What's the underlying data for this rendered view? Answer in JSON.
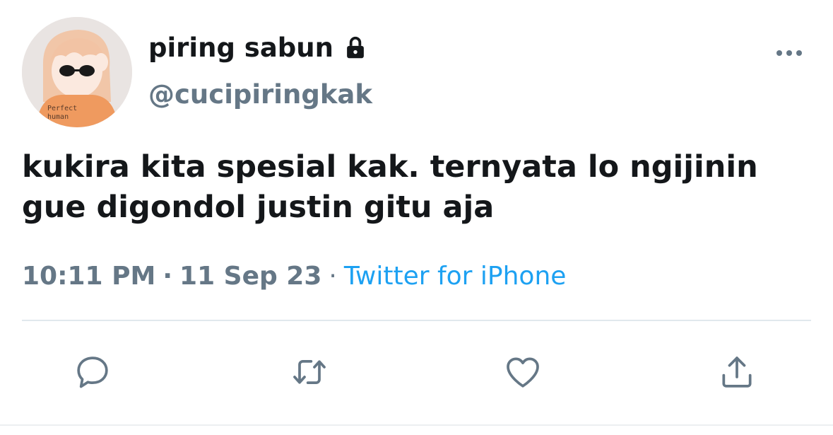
{
  "user": {
    "display_name": "piring sabun",
    "handle": "@cucipiringkak",
    "avatar_shirt_text": "Perfect human",
    "protected_icon": "lock-icon"
  },
  "tweet": {
    "text": "kukira kita spesial kak. ternyata lo ngijinin gue digondol justin gitu aja",
    "time": "10:11 PM",
    "date": "11 Sep 23",
    "separator": "·",
    "source": "Twitter for iPhone"
  },
  "actions": [
    {
      "name": "reply",
      "icon": "reply-icon"
    },
    {
      "name": "retweet",
      "icon": "retweet-icon"
    },
    {
      "name": "like",
      "icon": "heart-icon"
    },
    {
      "name": "share",
      "icon": "share-icon"
    }
  ],
  "colors": {
    "primary_text": "#14171a",
    "secondary_text": "#657786",
    "link": "#1da1f2",
    "divider": "#e1e8ed"
  }
}
